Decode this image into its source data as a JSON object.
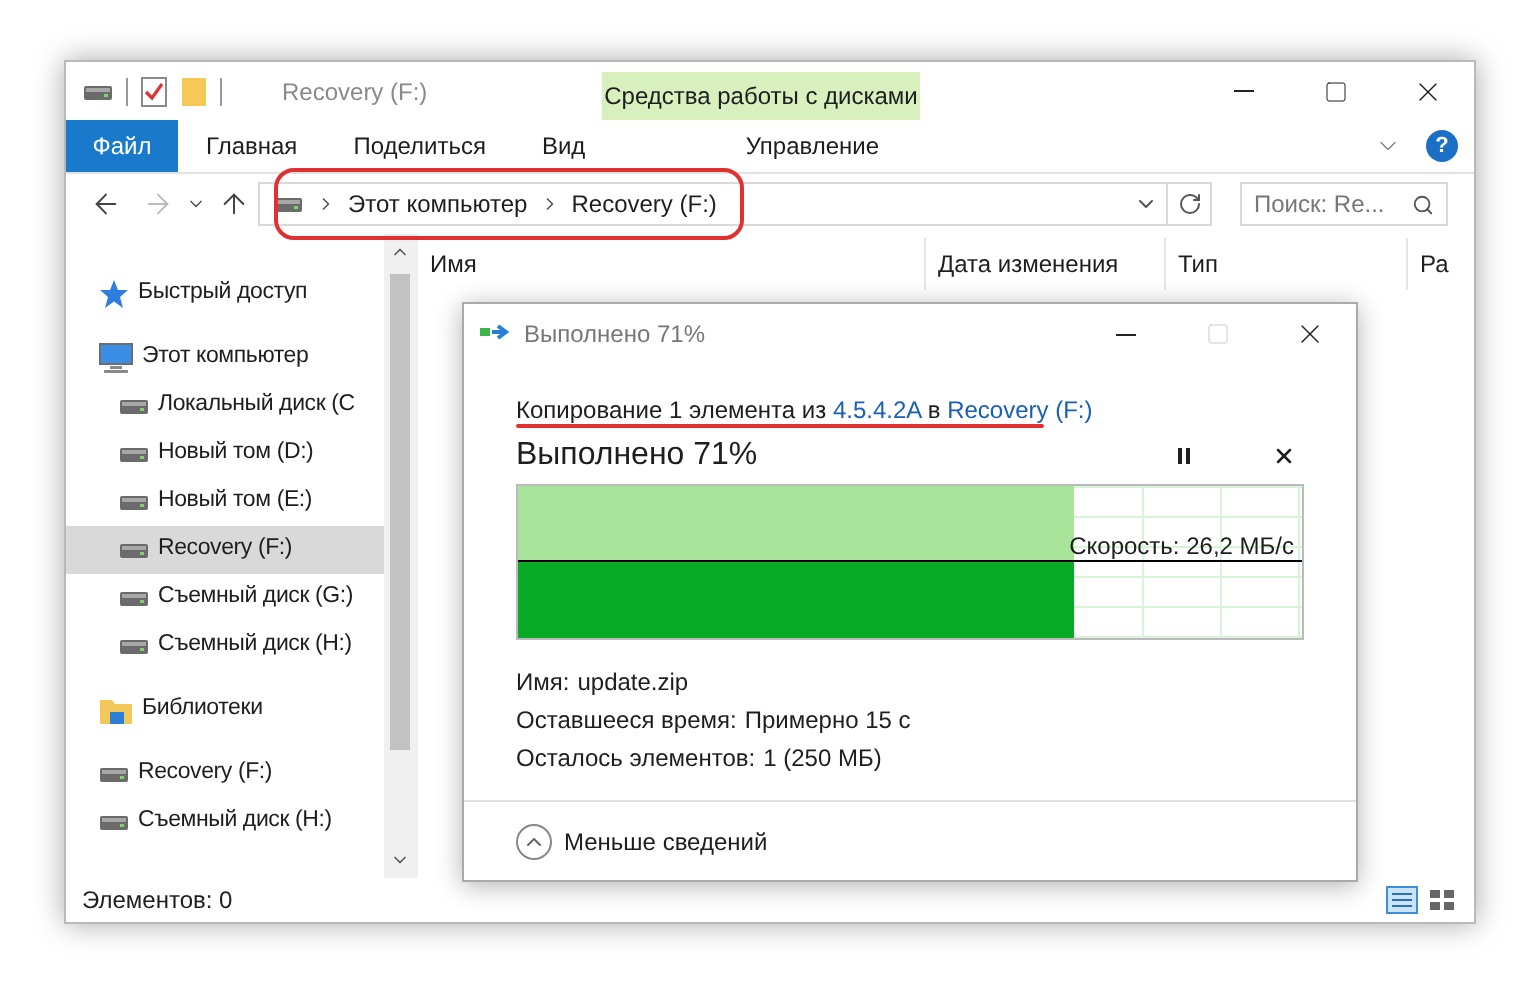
{
  "window": {
    "title": "Recovery (F:)"
  },
  "ribbon": {
    "context_group": "Средства работы с дисками",
    "help": "?",
    "tabs": [
      {
        "label": "Файл",
        "kind": "file",
        "selected": false
      },
      {
        "label": "Главная",
        "kind": "tab",
        "selected": false
      },
      {
        "label": "Поделиться",
        "kind": "tab",
        "selected": false
      },
      {
        "label": "Вид",
        "kind": "tab",
        "selected": false
      },
      {
        "label": "Управление",
        "kind": "context",
        "selected": false
      }
    ]
  },
  "address": {
    "crumbs": [
      "Этот компьютер",
      "Recovery (F:)"
    ]
  },
  "search": {
    "placeholder": "Поиск: Re..."
  },
  "columns": [
    "Имя",
    "Дата изменения",
    "Тип",
    "Ра"
  ],
  "sidebar": {
    "items": [
      {
        "label": "Быстрый доступ",
        "kind": "star",
        "selected": false
      },
      {
        "label": "Этот компьютер",
        "kind": "computer",
        "selected": false,
        "children": [
          {
            "label": "Локальный диск (C",
            "kind": "drive",
            "selected": false
          },
          {
            "label": "Новый том (D:)",
            "kind": "drive",
            "selected": false
          },
          {
            "label": "Новый том (E:)",
            "kind": "drive",
            "selected": false
          },
          {
            "label": "Recovery (F:)",
            "kind": "drive",
            "selected": true
          },
          {
            "label": "Съемный диск (G:)",
            "kind": "drive",
            "selected": false
          },
          {
            "label": "Съемный диск (H:)",
            "kind": "drive",
            "selected": false
          }
        ]
      },
      {
        "label": "Библиотеки",
        "kind": "library",
        "selected": false
      },
      {
        "label": "Recovery (F:)",
        "kind": "drive",
        "selected": false
      },
      {
        "label": "Съемный диск (H:)",
        "kind": "drive",
        "selected": false
      }
    ]
  },
  "status_bar": "Элементов: 0",
  "dialog": {
    "title": "Выполнено 71%",
    "summary": {
      "before": "Копирование 1 элемента из ",
      "source": "4.5.4.2A",
      "middle": " в ",
      "dest": "Recovery (F:)"
    },
    "heading": "Выполнено 71%",
    "level": 0.71,
    "speed": "Скорость: 26,2 МБ/с",
    "details": [
      {
        "label": "Имя:",
        "value": "update.zip"
      },
      {
        "label": "Оставшееся время:",
        "value": "Примерно 15 с"
      },
      {
        "label": "Осталось элементов:",
        "value": "1 (250 МБ)"
      }
    ],
    "toggle": "Меньше сведений"
  }
}
